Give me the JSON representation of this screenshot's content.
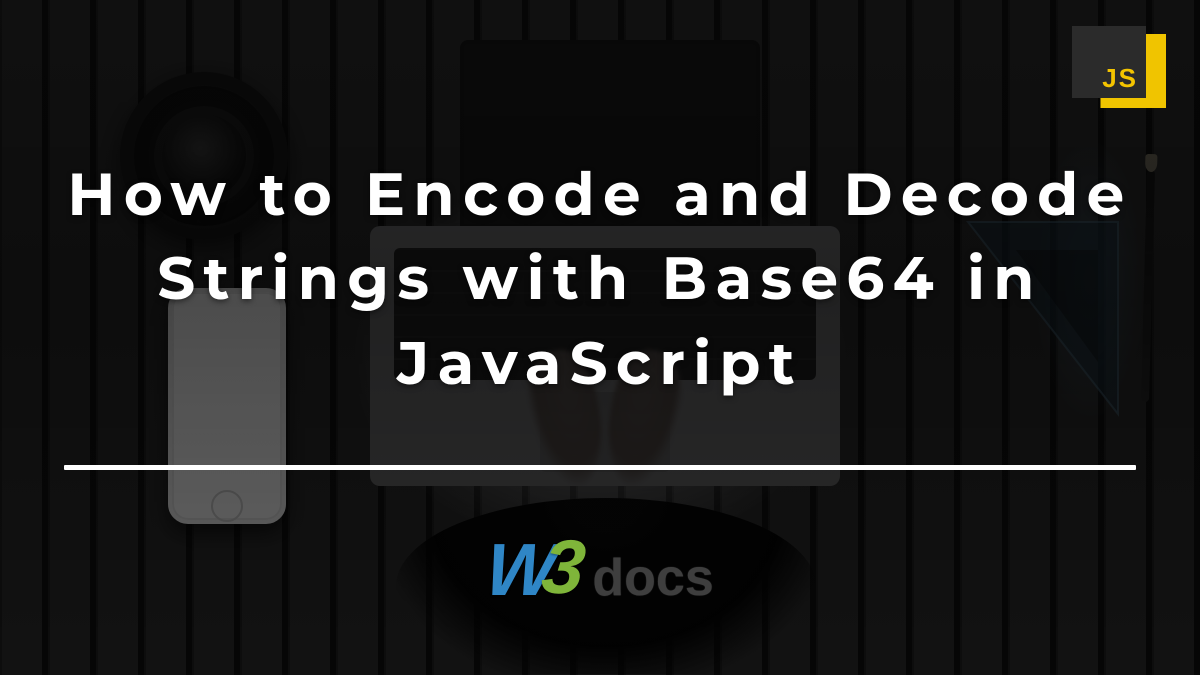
{
  "hero": {
    "title": "How to Encode and Decode Strings with Base64 in JavaScript"
  },
  "badge": {
    "label": "JS"
  },
  "brand": {
    "w": "W",
    "three": "3",
    "docs": "docs"
  },
  "colors": {
    "badge_yellow": "#f0c400",
    "badge_dark": "#2b2b2b",
    "brand_blue": "#2f86c6",
    "brand_green": "#7fb53a",
    "brand_gray": "#3e3e3e"
  }
}
